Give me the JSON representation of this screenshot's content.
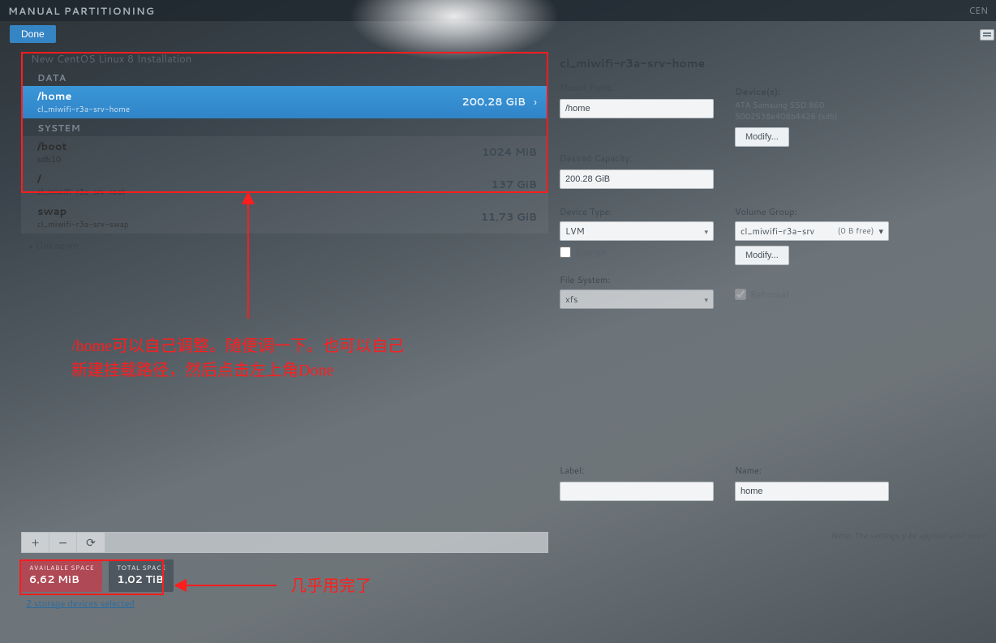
{
  "header": {
    "title": "MANUAL PARTITIONING",
    "distro": "CEN",
    "done_label": "Done"
  },
  "install_label": "New CentOS Linux 8 Installation",
  "sections": {
    "data": "DATA",
    "system": "SYSTEM",
    "unknown": "Unknown"
  },
  "partitions": {
    "home": {
      "name": "/home",
      "sub": "cl_miwifi-r3a-srv-home",
      "size": "200.28 GiB"
    },
    "boot": {
      "name": "/boot",
      "sub": "sdb10",
      "size": "1024 MiB"
    },
    "root": {
      "name": "/",
      "sub": "cl_miwifi-r3a-srv-root",
      "size": "137 GiB"
    },
    "swap": {
      "name": "swap",
      "sub": "cl_miwifi-r3a-srv-swap",
      "size": "11.73 GiB"
    }
  },
  "toolbar": {
    "add": "+",
    "remove": "−",
    "reload": "⟳"
  },
  "space": {
    "avail_label": "AVAILABLE SPACE",
    "avail_value": "6.62 MiB",
    "total_label": "TOTAL SPACE",
    "total_value": "1.02 TiB"
  },
  "storage_link": "2 storage devices selected",
  "right": {
    "title": "cl_miwifi-r3a-srv-home",
    "mount_point_label": "Mount Point:",
    "mount_point_value": "/home",
    "desired_cap_label": "Desired Capacity:",
    "desired_cap_value": "200.28 GiB",
    "devices_label": "Device(s):",
    "device_line1": "ATA Samsung SSD 860",
    "device_line2": "5002538e408b4426 (sdb)",
    "modify_label": "Modify...",
    "device_type_label": "Device Type:",
    "device_type_value": "LVM",
    "encrypt_label": "Encrypt",
    "volume_group_label": "Volume Group:",
    "volume_group_value": "cl_miwifi-r3a-srv",
    "volume_group_free": "(0 B free)",
    "filesystem_label": "File System:",
    "filesystem_value": "xfs",
    "reformat_label": "Reformat",
    "label_label": "Label:",
    "label_value": "",
    "name_label": "Name:",
    "name_value": "home",
    "note": "Note:  The settings y\n be applied until you c"
  },
  "annotations": {
    "text1": "/home可以自己调整。随便调一下。也可以自己\n新建挂载路径，然后点击左上角Done",
    "text2": "几乎用完了"
  }
}
